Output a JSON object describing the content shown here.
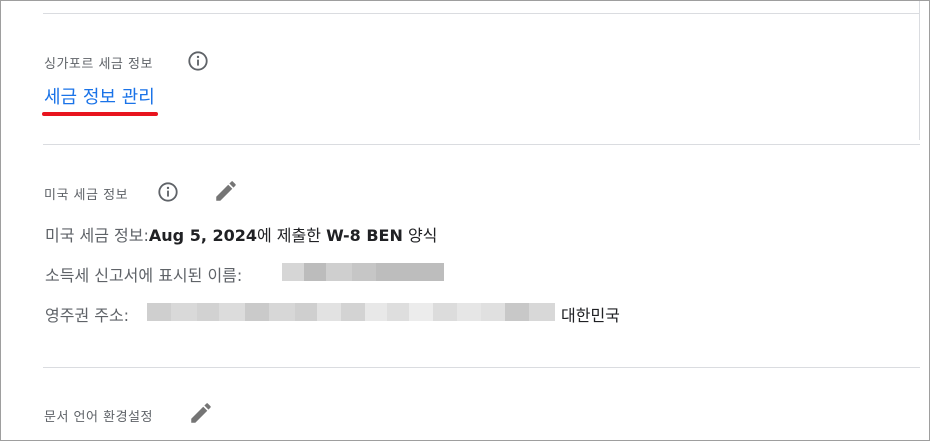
{
  "singapore": {
    "section_label": "싱가포르 세금 정보",
    "manage_link": "세금 정보 관리"
  },
  "us_tax": {
    "section_label": "미국 세금 정보",
    "row1_label": "미국 세금 정보:",
    "row1_date": "Aug 5, 2024",
    "row1_mid": "에 제출한 ",
    "row1_form": "W-8 BEN",
    "row1_tail": " 양식",
    "row2_label": "소득세 신고서에 표시된 이름:",
    "row3_label": "영주권 주소:",
    "row3_country": "대한민국"
  },
  "doc_lang": {
    "section_label": "문서 언어 환경설정"
  },
  "icons": {
    "info": "info-icon",
    "edit": "pencil-icon"
  },
  "colors": {
    "link": "#1a73e8",
    "annotation_underline": "#e8141e"
  }
}
